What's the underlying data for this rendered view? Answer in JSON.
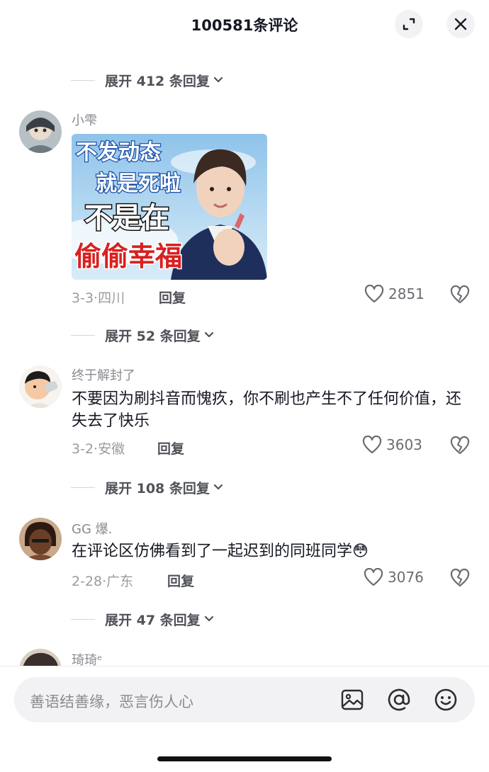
{
  "header": {
    "title": "100581条评论"
  },
  "top_expand": {
    "label": "展开 412 条回复"
  },
  "comments": [
    {
      "username": "小雫",
      "content": "",
      "sticker_lines": [
        "不发动态",
        "就是死啦",
        "不是在",
        "偷偷幸福"
      ],
      "date": "3-3",
      "region": "四川",
      "reply_label": "回复",
      "likes": "2851",
      "expand_label": "展开 52 条回复"
    },
    {
      "username": "终于解封了",
      "content": "不要因为刷抖音而愧疚，你不刷也产生不了任何价值，还失去了快乐",
      "date": "3-2",
      "region": "安徽",
      "reply_label": "回复",
      "likes": "3603",
      "expand_label": "展开 108 条回复"
    },
    {
      "username": "GG 爆.",
      "content": "在评论区仿佛看到了一起迟到的同班同学😳",
      "date": "2-28",
      "region": "广东",
      "reply_label": "回复",
      "likes": "3076",
      "expand_label": "展开 47 条回复"
    },
    {
      "username": "琦琦ᵉ"
    }
  ],
  "input": {
    "placeholder": "善语结善缘，恶言伤人心",
    "icons": [
      "image-icon",
      "mention-icon",
      "emoji-icon"
    ]
  },
  "colors": {
    "text": "#161823",
    "secondary": "#8a8b91",
    "background": "#ffffff"
  }
}
